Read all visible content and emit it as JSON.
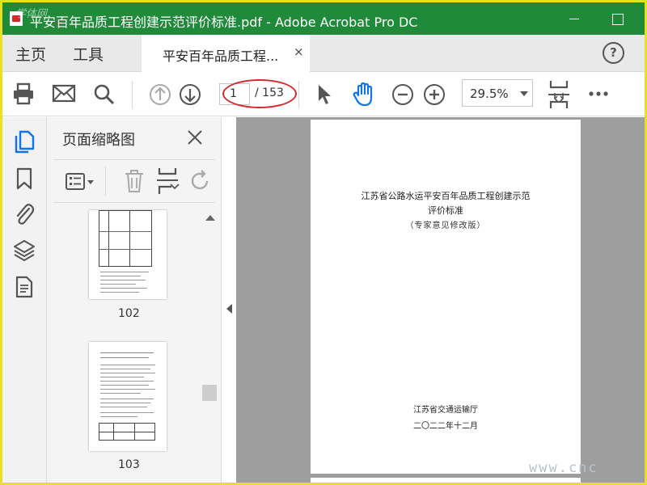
{
  "window": {
    "title": "平安百年品质工程创建示范评价标准.pdf - Adobe Acrobat Pro DC",
    "watermark": "学体网"
  },
  "tabs": {
    "home": "主页",
    "tools": "工具",
    "document": "平安百年品质工程...",
    "close": "×",
    "help": "?"
  },
  "toolbar": {
    "current_page": "1",
    "total_pages": "/ 153",
    "zoom": "29.5%"
  },
  "panel": {
    "title": "页面缩略图",
    "thumbnails": [
      {
        "page": "102"
      },
      {
        "page": "103"
      }
    ]
  },
  "document": {
    "title_line1": "江苏省公路水运平安百年品质工程创建示范",
    "title_line2": "评价标准",
    "subtitle": "（专家意见修改版）",
    "issuer": "江苏省交通运输厅",
    "date": "二〇二二年十二月",
    "watermark": "www.cnc"
  },
  "colors": {
    "titlebar": "#1e8a3a",
    "accent_blue": "#1473e6",
    "annotation_red": "#d42a2a",
    "frame_yellow": "#e8e020"
  }
}
